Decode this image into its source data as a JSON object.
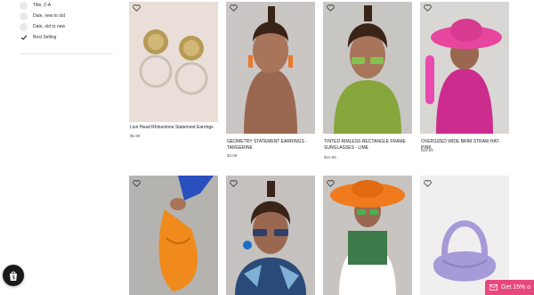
{
  "sort": {
    "options": [
      {
        "label": "Title, Z-A",
        "checked": false
      },
      {
        "label": "Date, new to old",
        "checked": false
      },
      {
        "label": "Date, old to new",
        "checked": false
      },
      {
        "label": "Best Selling",
        "checked": true
      }
    ]
  },
  "products": [
    {
      "title": "Lion Head Rhinestone Statement Earrings",
      "price": "$6.99"
    },
    {
      "title": "GEOMETRY STATEMENT EARRINGS - TANGERINE",
      "price": "$4.99"
    },
    {
      "title": "TINTED RIMLESS RECTANGLE FRAME SUNGLASSES - LIME",
      "price": "$10.99"
    },
    {
      "title": "OVERSIZED WIDE BRIM STRAW HAT- PINK",
      "price": "$19.99"
    }
  ],
  "promo": {
    "label": "Get 15% o"
  },
  "colors": {
    "accent": "#e8477e",
    "badge": "#1a1a1a"
  }
}
